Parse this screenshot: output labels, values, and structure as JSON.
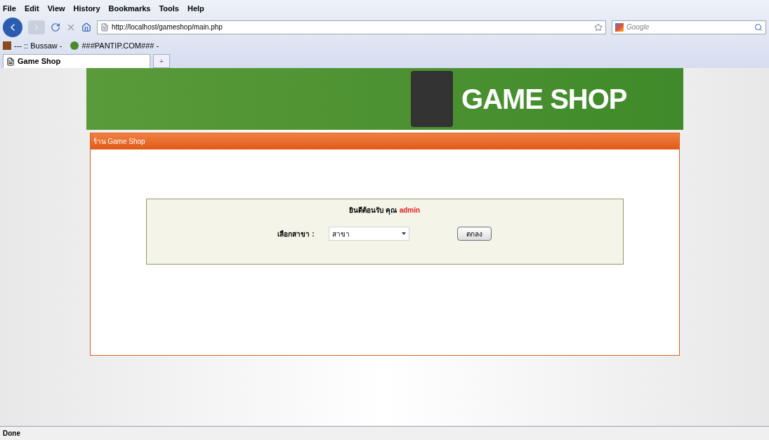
{
  "menu_bar": [
    "File",
    "Edit",
    "View",
    "History",
    "Bookmarks",
    "Tools",
    "Help"
  ],
  "address_bar": {
    "value": "http://localhost/gameshop/main.php"
  },
  "search": {
    "placeholder": "Google"
  },
  "bookmarks": [
    "--- :: Bussaw -",
    "###PANTIP.COM### -"
  ],
  "tabs": [
    {
      "label": "Game Shop",
      "selected": true
    }
  ],
  "new_tab": "+",
  "page": {
    "banner_title": "GAME SHOP",
    "panel_title": "ร้าน Game Shop",
    "welcome": "ยินดีต้อนรับ คุณ",
    "user": "admin",
    "branch_label": "เลือกสาขา :",
    "branch_value": "สาขา",
    "submit": "ตกลง"
  },
  "status_bar": "Done"
}
